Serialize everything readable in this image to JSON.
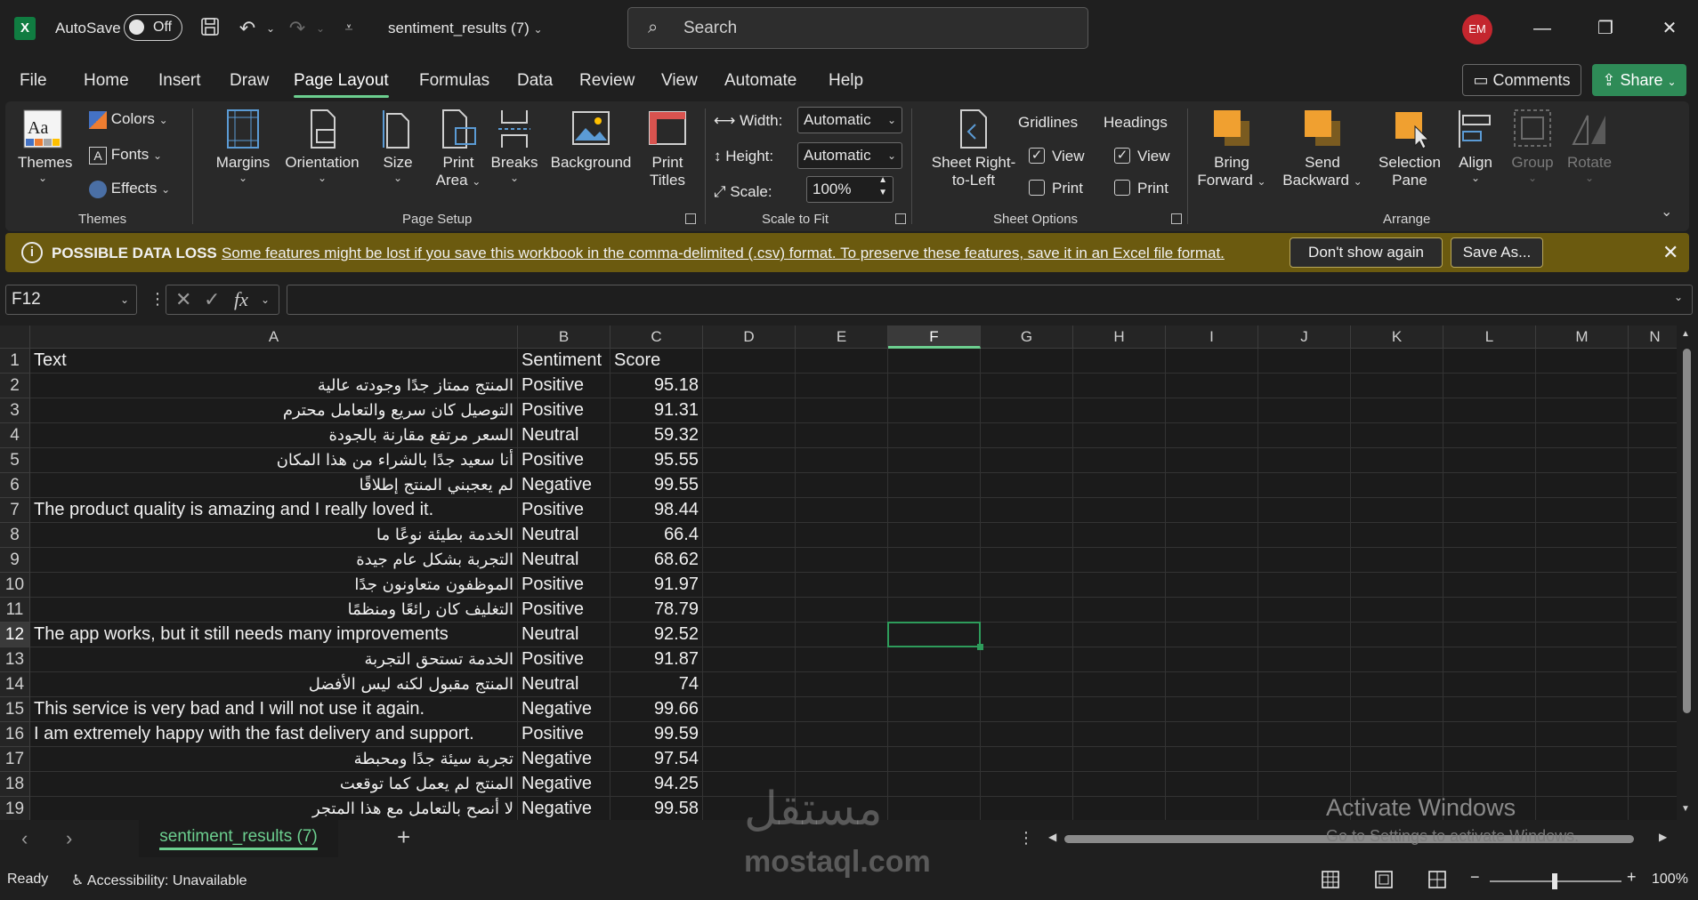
{
  "titlebar": {
    "autosave_label": "AutoSave",
    "autosave_state": "Off",
    "doc_title": "sentiment_results (7)",
    "search_placeholder": "Search",
    "avatar_initials": "EM"
  },
  "menu": [
    "File",
    "Home",
    "Insert",
    "Draw",
    "Page Layout",
    "Formulas",
    "Data",
    "Review",
    "View",
    "Automate",
    "Help"
  ],
  "menu_active": "Page Layout",
  "comments_label": "Comments",
  "share_label": "Share",
  "ribbon": {
    "themes": {
      "themes": "Themes",
      "colors": "Colors",
      "fonts": "Fonts",
      "effects": "Effects",
      "group": "Themes"
    },
    "page_setup": {
      "margins": "Margins",
      "orientation": "Orientation",
      "size": "Size",
      "print_area_1": "Print",
      "print_area_2": "Area",
      "breaks": "Breaks",
      "background": "Background",
      "print_titles_1": "Print",
      "print_titles_2": "Titles",
      "group": "Page Setup"
    },
    "scale": {
      "width_label": "Width:",
      "width_value": "Automatic",
      "height_label": "Height:",
      "height_value": "Automatic",
      "scale_label": "Scale:",
      "scale_value": "100%",
      "group": "Scale to Fit"
    },
    "sheet_options": {
      "rtl_1": "Sheet Right-",
      "rtl_2": "to-Left",
      "gridlines": "Gridlines",
      "headings": "Headings",
      "view": "View",
      "print": "Print",
      "group": "Sheet Options"
    },
    "arrange": {
      "bring_1": "Bring",
      "bring_2": "Forward",
      "send_1": "Send",
      "send_2": "Backward",
      "sel_1": "Selection",
      "sel_2": "Pane",
      "align": "Align",
      "group_btn": "Group",
      "rotate": "Rotate",
      "group": "Arrange"
    }
  },
  "warning": {
    "title": "POSSIBLE DATA LOSS",
    "message": "Some features might be lost if you save this workbook in the comma-delimited (.csv) format. To preserve these features, save it in an Excel file format.",
    "dont_show": "Don't show again",
    "save_as": "Save As..."
  },
  "formula_bar": {
    "name_box": "F12",
    "formula": ""
  },
  "columns": [
    "A",
    "B",
    "C",
    "D",
    "E",
    "F",
    "G",
    "H",
    "I",
    "J",
    "K",
    "L",
    "M",
    "N"
  ],
  "selected_column": "F",
  "selected_row": 12,
  "rows": [
    {
      "n": "1",
      "a": "Text",
      "b": "Sentiment",
      "c": "Score",
      "rtl": false,
      "header": true
    },
    {
      "n": "2",
      "a": "المنتج ممتاز جدًا وجودته عالية",
      "b": "Positive",
      "c": "95.18",
      "rtl": true
    },
    {
      "n": "3",
      "a": "التوصيل كان سريع والتعامل محترم",
      "b": "Positive",
      "c": "91.31",
      "rtl": true
    },
    {
      "n": "4",
      "a": "السعر مرتفع مقارنة بالجودة",
      "b": "Neutral",
      "c": "59.32",
      "rtl": true
    },
    {
      "n": "5",
      "a": "أنا سعيد جدًا بالشراء من هذا المكان",
      "b": "Positive",
      "c": "95.55",
      "rtl": true
    },
    {
      "n": "6",
      "a": "لم يعجبني المنتج إطلاقًا",
      "b": "Negative",
      "c": "99.55",
      "rtl": true
    },
    {
      "n": "7",
      "a": "The product quality is amazing and I really loved it.",
      "b": "Positive",
      "c": "98.44",
      "rtl": false
    },
    {
      "n": "8",
      "a": "الخدمة بطيئة نوعًا ما",
      "b": "Neutral",
      "c": "66.4",
      "rtl": true
    },
    {
      "n": "9",
      "a": "التجربة بشكل عام جيدة",
      "b": "Neutral",
      "c": "68.62",
      "rtl": true
    },
    {
      "n": "10",
      "a": "الموظفون متعاونون جدًا",
      "b": "Positive",
      "c": "91.97",
      "rtl": true
    },
    {
      "n": "11",
      "a": "التغليف كان رائعًا ومنظمًا",
      "b": "Positive",
      "c": "78.79",
      "rtl": true
    },
    {
      "n": "12",
      "a": "The app works, but it still needs many improvements",
      "b": "Neutral",
      "c": "92.52",
      "rtl": false
    },
    {
      "n": "13",
      "a": "الخدمة تستحق التجربة",
      "b": "Positive",
      "c": "91.87",
      "rtl": true
    },
    {
      "n": "14",
      "a": "المنتج مقبول لكنه ليس الأفضل",
      "b": "Neutral",
      "c": "74",
      "rtl": true
    },
    {
      "n": "15",
      "a": "This service is very bad and I will not use it again.",
      "b": "Negative",
      "c": "99.66",
      "rtl": false
    },
    {
      "n": "16",
      "a": "I am extremely happy with the fast delivery and support.",
      "b": "Positive",
      "c": "99.59",
      "rtl": false
    },
    {
      "n": "17",
      "a": "تجربة سيئة جدًا ومحبطة",
      "b": "Negative",
      "c": "97.54",
      "rtl": true
    },
    {
      "n": "18",
      "a": "المنتج لم يعمل كما توقعت",
      "b": "Negative",
      "c": "94.25",
      "rtl": true
    },
    {
      "n": "19",
      "a": "لا أنصح بالتعامل مع هذا المتجر",
      "b": "Negative",
      "c": "99.58",
      "rtl": true
    }
  ],
  "sheet_tab": "sentiment_results (7)",
  "status": {
    "ready": "Ready",
    "accessibility": "Accessibility: Unavailable",
    "zoom": "100%"
  },
  "overlay": {
    "activate_title": "Activate Windows",
    "activate_sub": "Go to Settings to activate Windows.",
    "watermark_ar": "مستقل",
    "watermark_en": "mostaql.com"
  },
  "colors": {
    "accent_green": "#6ccf8f",
    "share_green": "#2e8b57",
    "warning_bg": "#6b5a0f",
    "avatar_red": "#c4262e"
  }
}
